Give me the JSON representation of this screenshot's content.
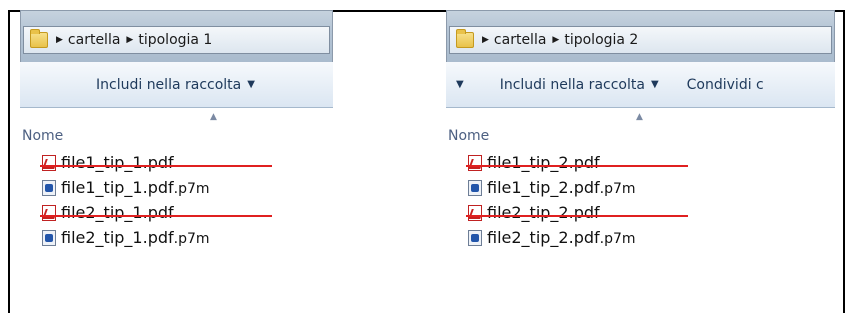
{
  "left_window": {
    "breadcrumb": [
      "cartella",
      "tipologia 1"
    ],
    "toolbar": {
      "include_label": "Includi nella raccolta"
    },
    "column_header": "Nome",
    "files": [
      {
        "name": "file1_tip_1.pdf",
        "ext_extra": "",
        "type": "pdf-icon",
        "struck": true
      },
      {
        "name": "file1_tip_1.pdf",
        "ext_extra": ".p7m",
        "type": "p7m-icon",
        "struck": false
      },
      {
        "name": "file2_tip_1.pdf",
        "ext_extra": "",
        "type": "pdf-icon",
        "struck": true
      },
      {
        "name": "file2_tip_1.pdf",
        "ext_extra": ".p7m",
        "type": "p7m-icon",
        "struck": false
      }
    ]
  },
  "right_window": {
    "breadcrumb": [
      "cartella",
      "tipologia 2"
    ],
    "toolbar": {
      "include_label": "Includi nella raccolta",
      "share_label": "Condividi c"
    },
    "column_header": "Nome",
    "files": [
      {
        "name": "file1_tip_2.pdf",
        "ext_extra": "",
        "type": "pdf-icon",
        "struck": true
      },
      {
        "name": "file1_tip_2.pdf",
        "ext_extra": ".p7m",
        "type": "p7m-icon",
        "struck": false
      },
      {
        "name": "file2_tip_2.pdf",
        "ext_extra": "",
        "type": "pdf-icon",
        "struck": true
      },
      {
        "name": "file2_tip_2.pdf",
        "ext_extra": ".p7m",
        "type": "p7m-icon",
        "struck": false
      }
    ]
  },
  "colors": {
    "strike": "#e02020",
    "toolbar_text": "#1e395b",
    "header_text": "#4d6082"
  }
}
